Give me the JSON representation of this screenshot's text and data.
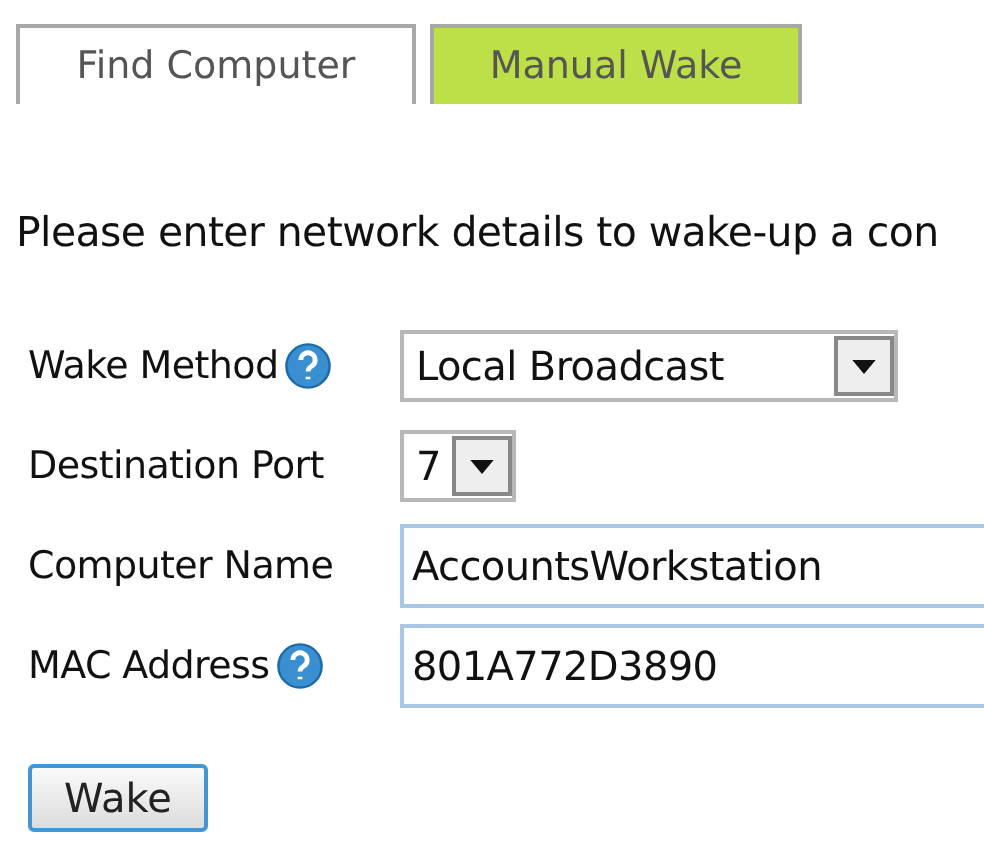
{
  "tabs": [
    {
      "label": "Find Computer",
      "selected": false
    },
    {
      "label": "Manual Wake",
      "selected": true
    }
  ],
  "instruction": "Please enter network details to wake-up a con",
  "fields": [
    {
      "kind": "select",
      "label": "Wake Method",
      "help": true,
      "value": "Local Broadcast"
    },
    {
      "kind": "select",
      "label": "Destination Port",
      "help": false,
      "value": "7"
    },
    {
      "kind": "text",
      "label": "Computer Name",
      "help": false,
      "value": "AccountsWorkstation"
    },
    {
      "kind": "text",
      "label": "MAC Address",
      "help": true,
      "value": "801A772D3890"
    }
  ],
  "button": "Wake"
}
